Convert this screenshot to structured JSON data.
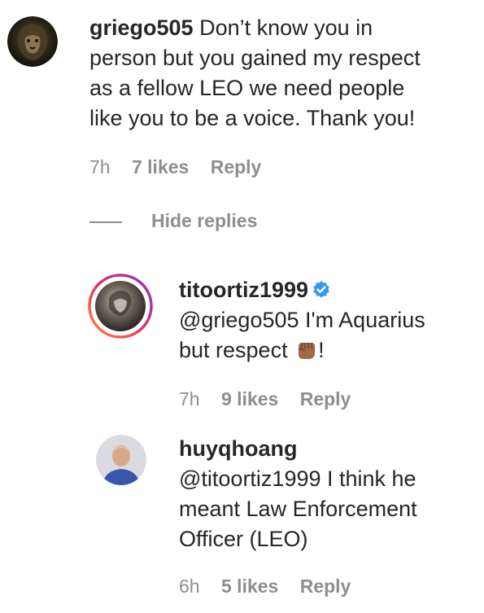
{
  "comments": [
    {
      "username": "griego505",
      "lines": [
        "Don’t know you in",
        "person but you gained my respect",
        "as a fellow LEO we need people",
        "like you to be a voice. Thank you!"
      ],
      "time": "7h",
      "likes": "7 likes",
      "reply": "Reply"
    }
  ],
  "hide_replies": "Hide replies",
  "replies": [
    {
      "username": "titoortiz1999",
      "verified": true,
      "lines": [
        "@griego505 I'm Aquarius",
        "but respect",
        "!"
      ],
      "emoji": "raised-fist-icon",
      "time": "7h",
      "likes": "9 likes",
      "reply": "Reply"
    },
    {
      "username": "huyqhoang",
      "lines": [
        "@titoortiz1999 I think he",
        "meant Law Enforcement",
        "Officer (LEO)"
      ],
      "time": "6h",
      "likes": "5 likes",
      "reply": "Reply"
    }
  ],
  "colors": {
    "text": "#262626",
    "meta": "#8e8e8e",
    "verified": "#3897f0",
    "story_ring_start": "#c13584",
    "story_ring_end": "#fd8d32"
  }
}
